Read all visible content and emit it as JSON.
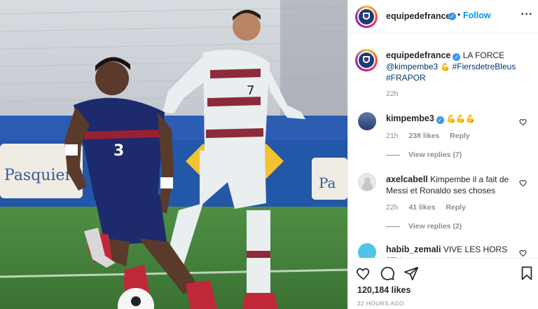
{
  "post": {
    "username": "equipedefrance",
    "follow_label": "Follow",
    "caption_text": "LA FORCE",
    "caption_mention": "@kimpembe3",
    "caption_tags": "#FiersdetreBleus",
    "caption_tags2": "#FRAPOR",
    "caption_time": "22h",
    "likes": "120,184 likes",
    "posted_ago": "22 HOURS AGO"
  },
  "photo": {
    "player_front_number": "3",
    "player_back_number": "7",
    "billboard_left": "Pasquier",
    "billboard_right": "Pa"
  },
  "comments": [
    {
      "username": "kimpembe3",
      "verified": true,
      "text": "",
      "time": "21h",
      "likes": "238 likes",
      "reply_label": "Reply",
      "view_replies": "View replies (7)"
    },
    {
      "username": "axelcabell",
      "verified": false,
      "text": "Kimpembe il a fait de Messi et Ronaldo ses choses",
      "time": "22h",
      "likes": "41 likes",
      "reply_label": "Reply",
      "view_replies": "View replies (2)"
    },
    {
      "username": "habib_zemali",
      "verified": false,
      "text": "VIVE LES HORS JEU"
    }
  ],
  "icons": {
    "verified": "verified-badge-icon",
    "more": "more-options-icon",
    "like": "heart-icon",
    "comment": "comment-bubble-icon",
    "share": "paper-plane-icon",
    "save": "bookmark-icon",
    "emoji": "flexed-biceps-emoji"
  },
  "colors": {
    "follow_blue": "#0095f6",
    "verified_blue": "#3897f0",
    "france_navy": "#1d2a6b",
    "portugal_white": "#e9eef0",
    "pitch_green": "#3f7a3a"
  }
}
